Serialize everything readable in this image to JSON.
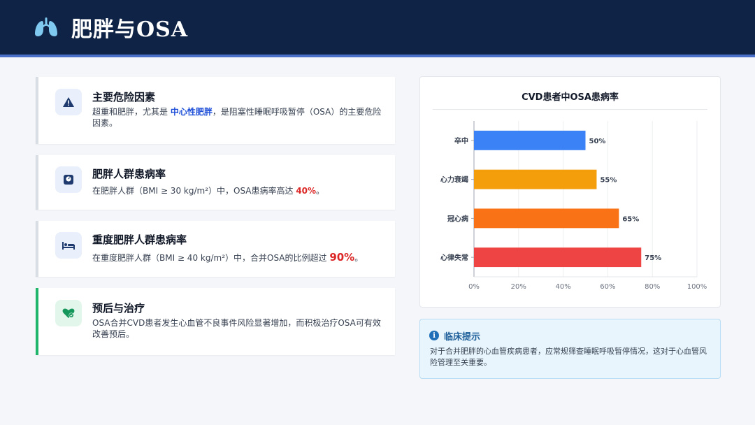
{
  "header": {
    "title": "肥胖与OSA",
    "icon": "lungs-icon"
  },
  "cards": [
    {
      "icon": "warning-icon",
      "title": "主要危险因素",
      "body_pre": "超重和肥胖，尤其是 ",
      "body_hl": "中心性肥胖",
      "body_post": "，是阻塞性睡眠呼吸暂停（OSA）的主要危险因素。"
    },
    {
      "icon": "scale-icon",
      "title": "肥胖人群患病率",
      "body_pre": "在肥胖人群（BMI ≥ 30 kg/m²）中，OSA患病率高达 ",
      "body_hl": "40%",
      "body_post": "。"
    },
    {
      "icon": "bed-icon",
      "title": "重度肥胖人群患病率",
      "body_pre": "在重度肥胖人群（BMI ≥ 40 kg/m²）中，合并OSA的比例超过 ",
      "body_hl": "90%",
      "body_post": "。"
    },
    {
      "icon": "heart-check-icon",
      "title": "预后与治疗",
      "body": "OSA合并CVD患者发生心血管不良事件风险显著增加，而积极治疗OSA可有效改善预后。"
    }
  ],
  "chart_data": {
    "type": "bar",
    "orientation": "horizontal",
    "title": "CVD患者中OSA患病率",
    "categories": [
      "卒中",
      "心力衰竭",
      "冠心病",
      "心律失常"
    ],
    "values": [
      50,
      55,
      65,
      75
    ],
    "value_labels": [
      "50%",
      "55%",
      "65%",
      "75%"
    ],
    "colors": [
      "#3b82f6",
      "#f59e0b",
      "#f97316",
      "#ef4444"
    ],
    "xlim": [
      0,
      100
    ],
    "xticks": [
      0,
      20,
      40,
      60,
      80,
      100
    ],
    "xtick_labels": [
      "0%",
      "20%",
      "40%",
      "60%",
      "80%",
      "100%"
    ],
    "grid": true
  },
  "tip": {
    "title": "临床提示",
    "body": "对于合并肥胖的心血管疾病患者，应常规筛查睡眠呼吸暂停情况，这对于心血管风险管理至关重要。"
  }
}
